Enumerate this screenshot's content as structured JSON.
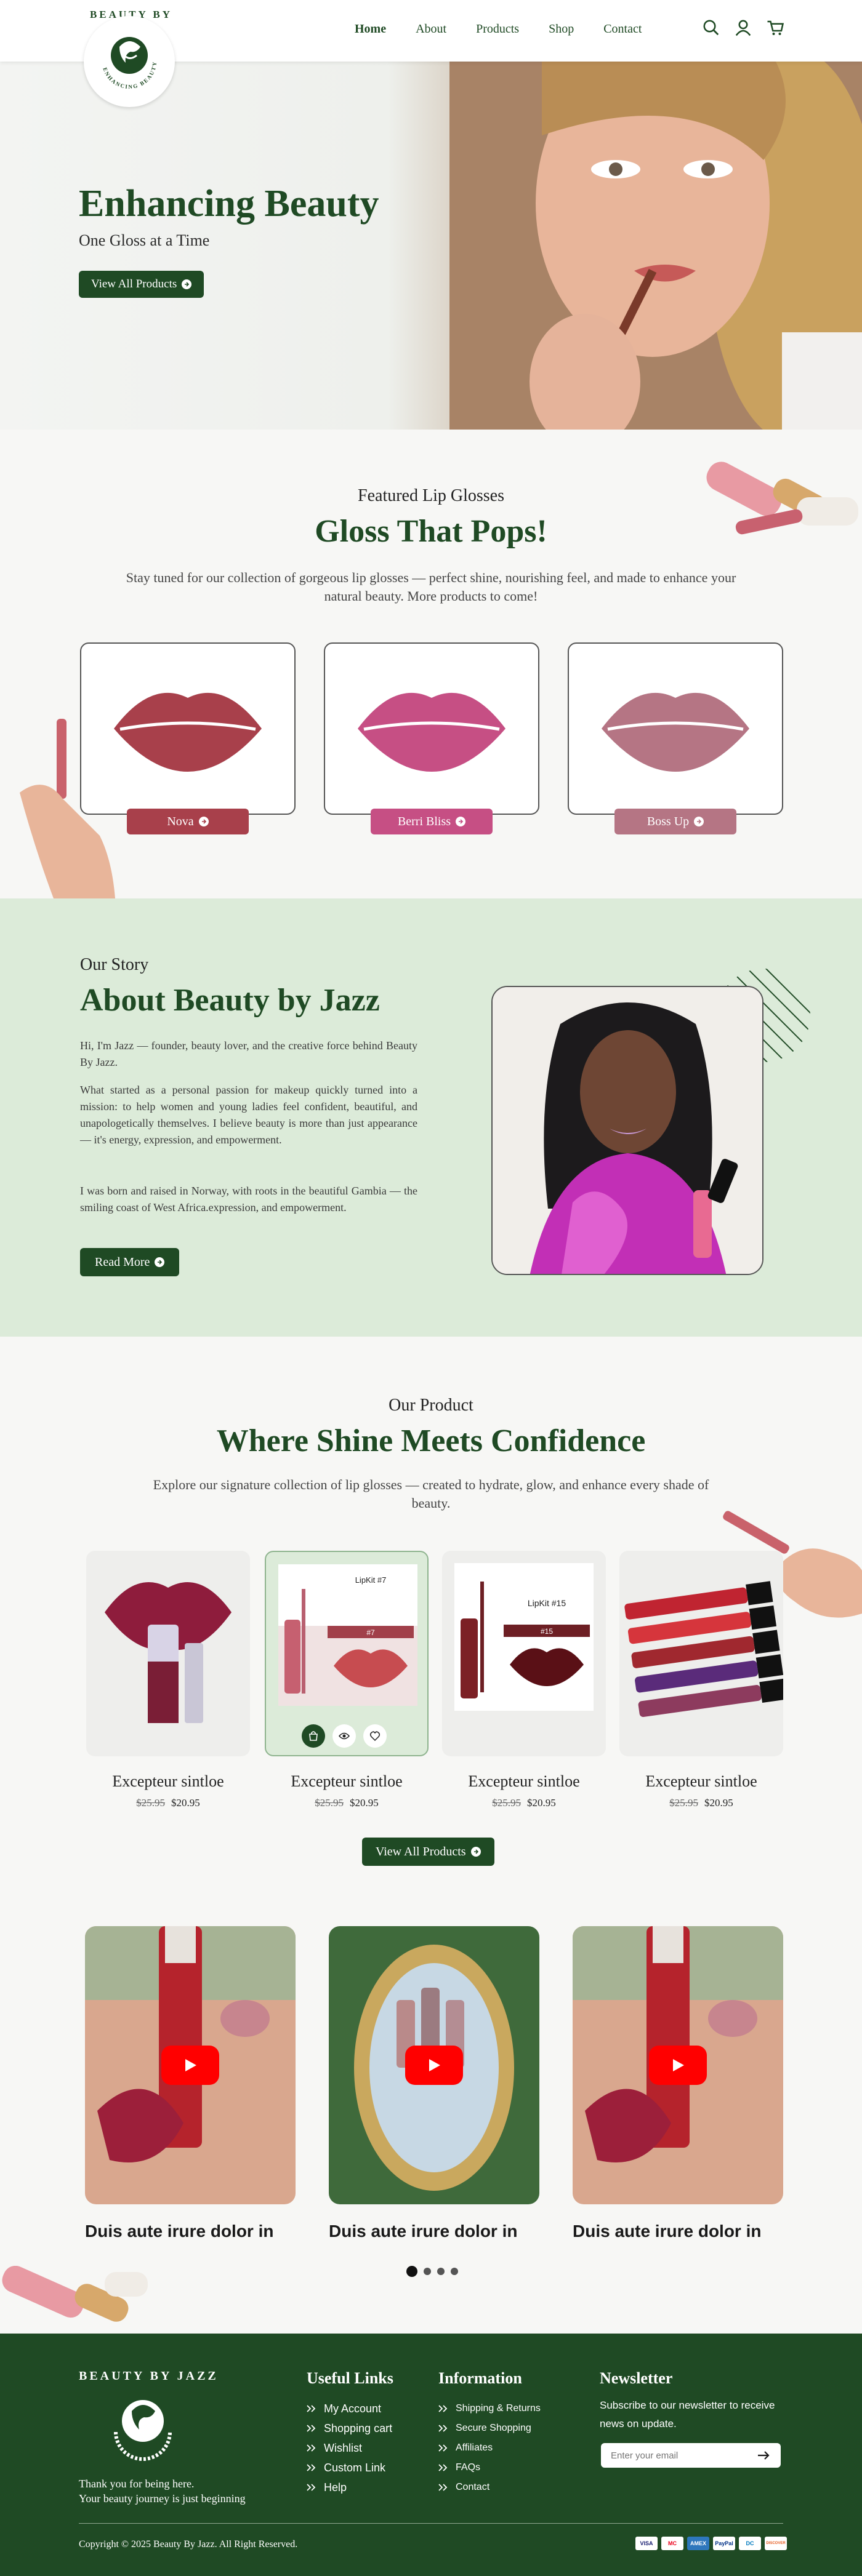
{
  "header": {
    "logo_text": "BEAUTY BY JAZZ",
    "logo_ring_text": "ENHANCING BEAUTY",
    "nav": [
      "Home",
      "About",
      "Products",
      "Shop",
      "Contact"
    ],
    "icons": [
      "search-icon",
      "account-icon",
      "cart-icon"
    ]
  },
  "hero": {
    "title": "Enhancing Beauty",
    "subtitle": "One Gloss at a Time",
    "button": "View All Products"
  },
  "featured": {
    "kicker": "Featured Lip Glosses",
    "title": "Gloss That Pops!",
    "description": "Stay tuned for our collection of gorgeous lip glosses — perfect shine, nourishing feel, and made to enhance your natural beauty. More products to come!",
    "items": [
      {
        "name": "Nova",
        "color": "#a8404b"
      },
      {
        "name": "Berri Bliss",
        "color": "#c64f84"
      },
      {
        "name": "Boss Up",
        "color": "#b57584"
      }
    ]
  },
  "about": {
    "kicker": "Our Story",
    "title": "About Beauty by Jazz",
    "paragraphs": [
      "Hi, I'm Jazz — founder, beauty lover, and the creative force behind Beauty By Jazz.",
      "What started as a personal passion for makeup quickly turned into a mission: to help women and young ladies feel confident, beautiful, and unapologetically themselves. I believe beauty is more than just appearance — it's energy, expression, and empowerment.",
      "I was born and raised in Norway, with roots in the beautiful Gambia — the smiling coast of West Africa.expression, and empowerment."
    ],
    "button": "Read More"
  },
  "products": {
    "kicker": "Our Product",
    "title": "Where Shine Meets Confidence",
    "description": "Explore our signature collection of lip glosses — created to hydrate, glow, and enhance every shade of beauty.",
    "items": [
      {
        "name": "Excepteur sintloe",
        "old_price": "$25.95",
        "price": "$20.95"
      },
      {
        "name": "Excepteur sintloe",
        "old_price": "$25.95",
        "price": "$20.95",
        "label_top": "LipKit #7",
        "label_bar": "#7"
      },
      {
        "name": "Excepteur sintloe",
        "old_price": "$25.95",
        "price": "$20.95",
        "label_top": "LipKit #15",
        "label_bar": "#15"
      },
      {
        "name": "Excepteur sintloe",
        "old_price": "$25.95",
        "price": "$20.95"
      }
    ],
    "button": "View All Products"
  },
  "videos": {
    "items": [
      {
        "title": "Duis aute irure dolor in"
      },
      {
        "title": "Duis aute irure dolor in"
      },
      {
        "title": "Duis aute irure dolor in"
      }
    ],
    "pagination": {
      "pages": 4,
      "current": 1
    }
  },
  "footer": {
    "logo_text": "BEAUTY BY JAZZ",
    "tagline_1": "Thank you for being here.",
    "tagline_2": "Your beauty journey is just beginning",
    "useful_links": {
      "title": "Useful Links",
      "items": [
        "My Account",
        "Shopping cart",
        "Wishlist",
        "Custom Link",
        "Help"
      ]
    },
    "information": {
      "title": "Information",
      "items": [
        "Shipping & Returns",
        "Secure Shopping",
        "Affiliates",
        "FAQs",
        "Contact"
      ]
    },
    "newsletter": {
      "title": "Newsletter",
      "text": "Subscribe to our newsletter to receive news on update.",
      "placeholder": "Enter your email"
    },
    "copyright": "Copyright © 2025 Beauty By Jazz. All Right Reserved.",
    "payments": [
      "VISA",
      "MC",
      "AMEX",
      "PayPal",
      "DC",
      "DISCOVER"
    ]
  },
  "colors": {
    "brand_green": "#1f4a24",
    "light_green": "#dcebd9",
    "youtube_red": "#ff0000"
  }
}
